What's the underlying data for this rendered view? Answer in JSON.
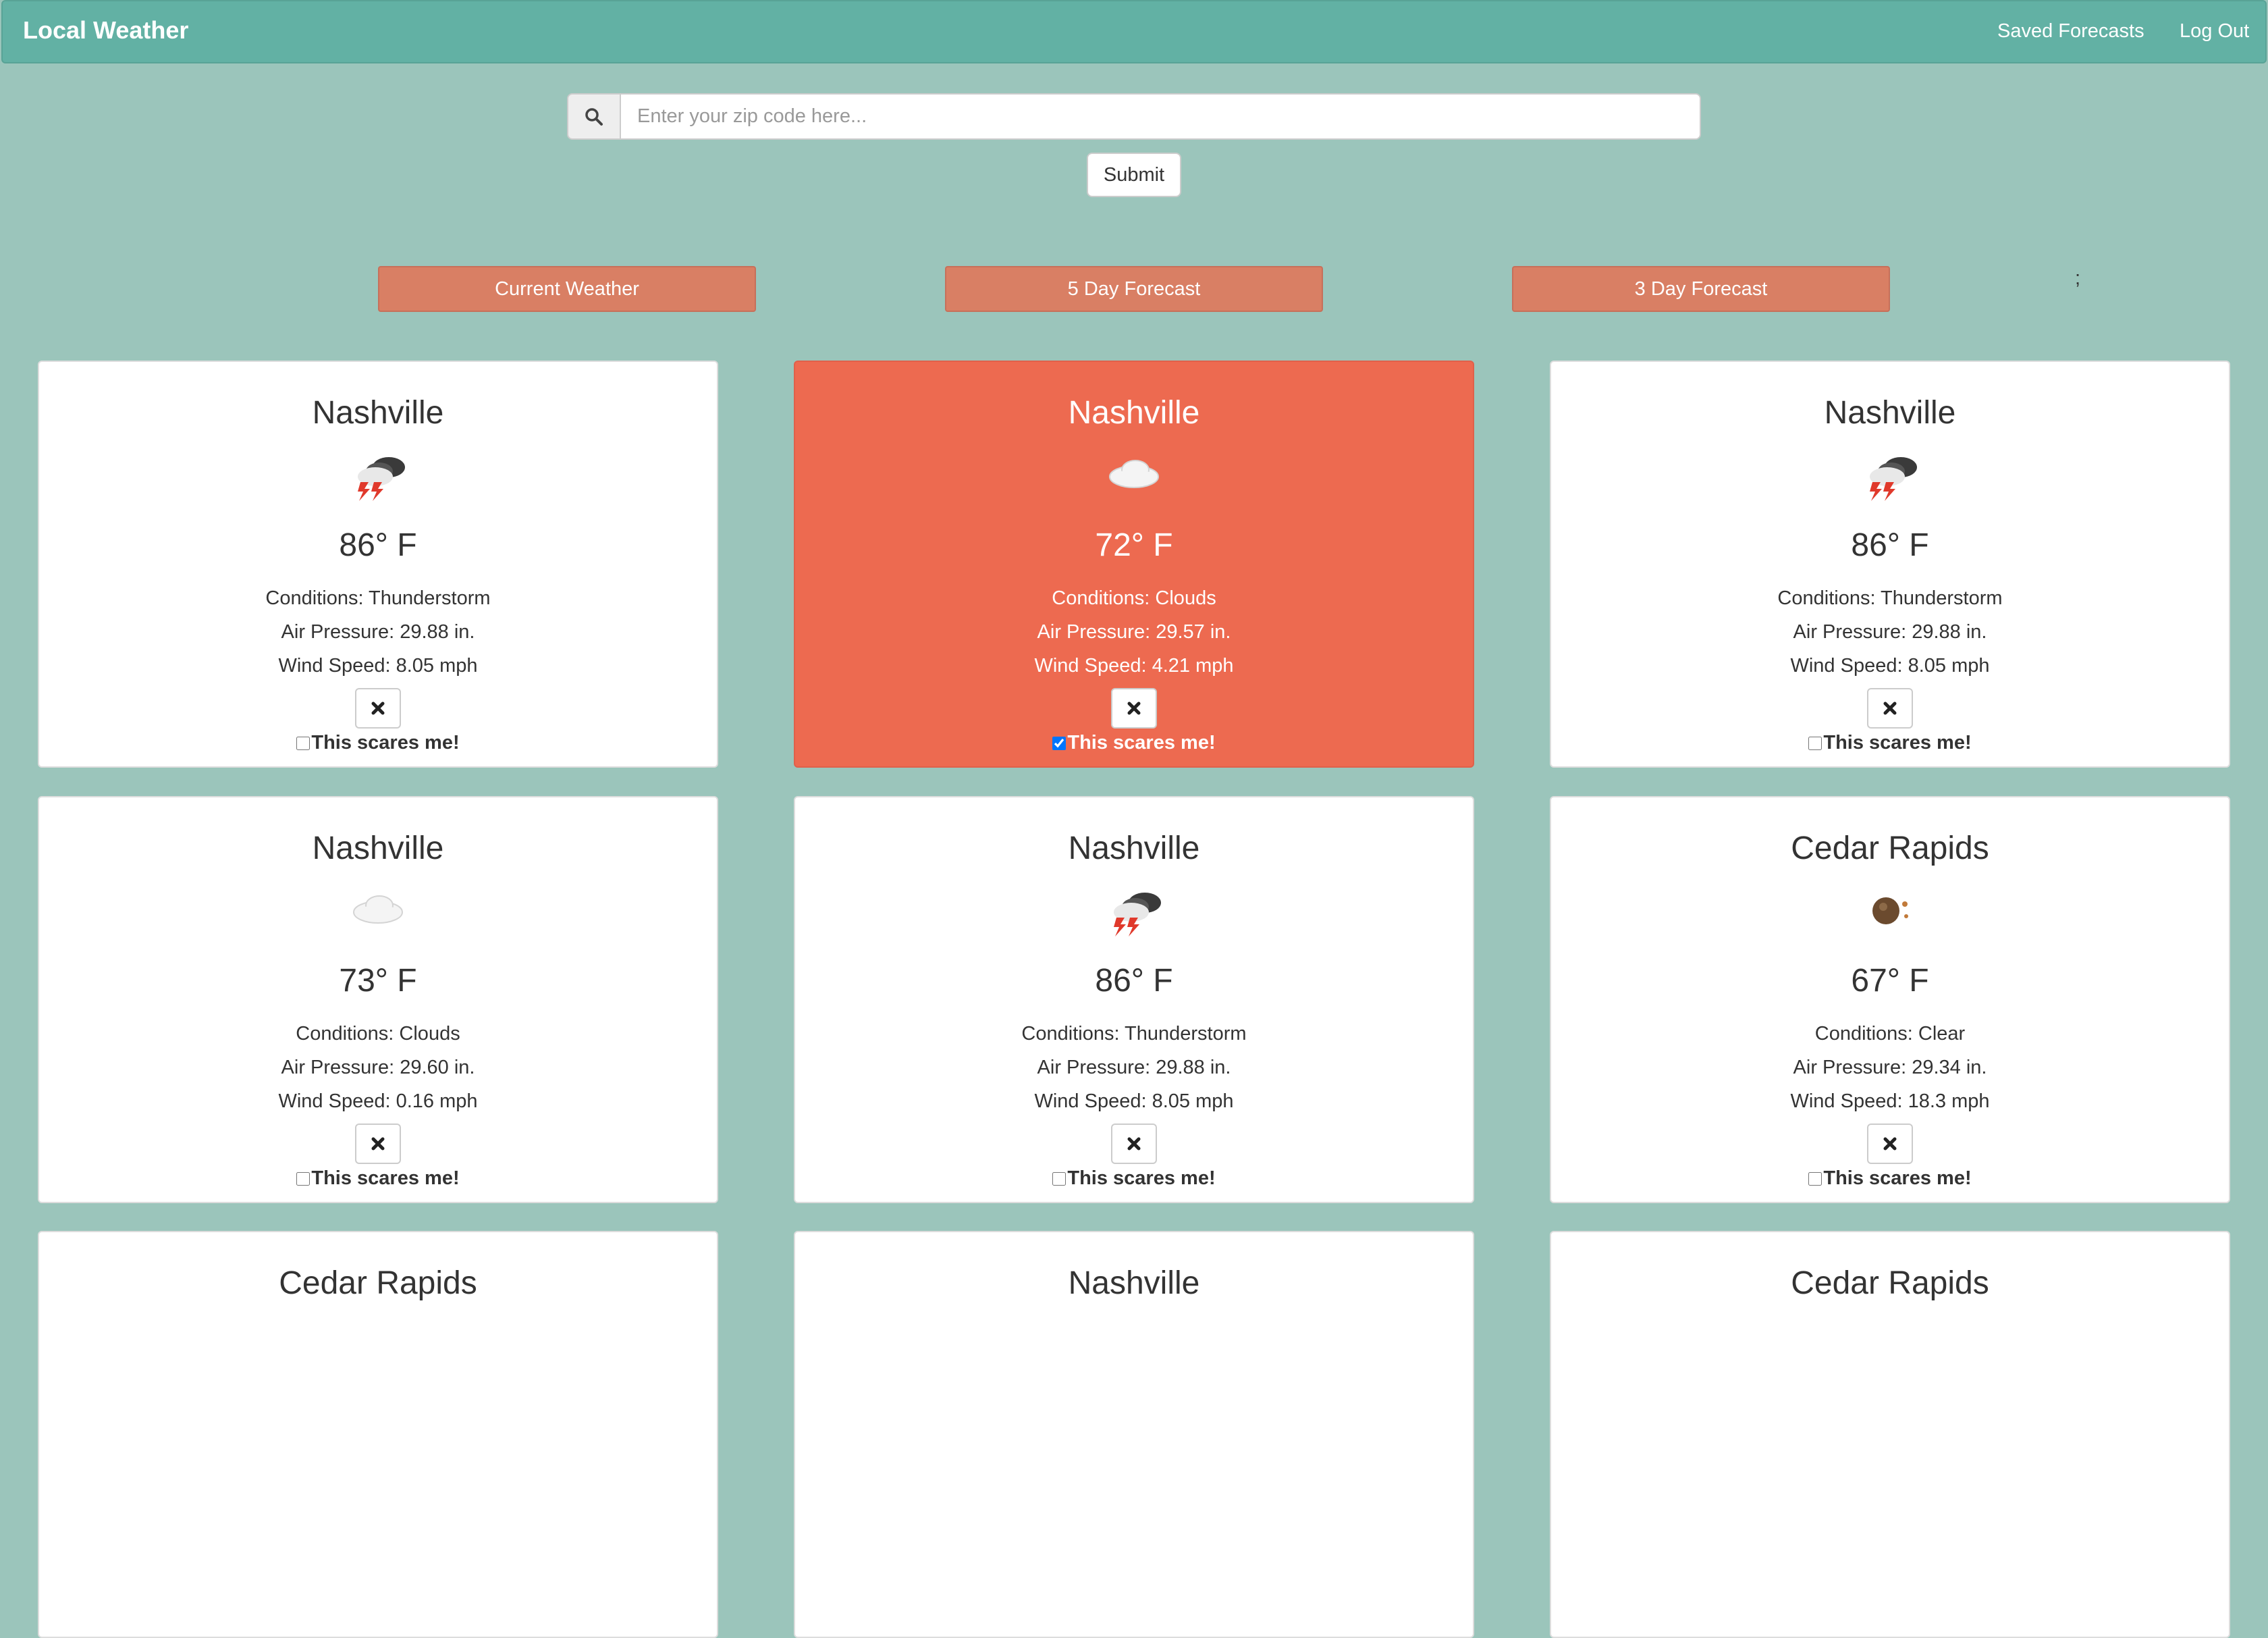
{
  "nav": {
    "brand": "Local Weather",
    "saved": "Saved Forecasts",
    "logout": "Log Out"
  },
  "search": {
    "placeholder": "Enter your zip code here...",
    "value": "",
    "submit": "Submit"
  },
  "tabs": [
    "Current Weather",
    "5 Day Forecast",
    "3 Day Forecast"
  ],
  "stray_text": ";",
  "cards": [
    {
      "city": "Nashville",
      "icon": "thunderstorm-icon",
      "temp": "86° F",
      "conditions": "Conditions: Thunderstorm",
      "pressure": "Air Pressure: 29.88 in.",
      "wind": "Wind Speed: 8.05 mph",
      "scare_label": "This scares me!",
      "checked": false
    },
    {
      "city": "Nashville",
      "icon": "cloud-icon",
      "temp": "72° F",
      "conditions": "Conditions: Clouds",
      "pressure": "Air Pressure: 29.57 in.",
      "wind": "Wind Speed: 4.21 mph",
      "scare_label": "This scares me!",
      "checked": true
    },
    {
      "city": "Nashville",
      "icon": "thunderstorm-icon",
      "temp": "86° F",
      "conditions": "Conditions: Thunderstorm",
      "pressure": "Air Pressure: 29.88 in.",
      "wind": "Wind Speed: 8.05 mph",
      "scare_label": "This scares me!",
      "checked": false
    },
    {
      "city": "Nashville",
      "icon": "cloud-icon",
      "temp": "73° F",
      "conditions": "Conditions: Clouds",
      "pressure": "Air Pressure: 29.60 in.",
      "wind": "Wind Speed: 0.16 mph",
      "scare_label": "This scares me!",
      "checked": false
    },
    {
      "city": "Nashville",
      "icon": "thunderstorm-icon",
      "temp": "86° F",
      "conditions": "Conditions: Thunderstorm",
      "pressure": "Air Pressure: 29.88 in.",
      "wind": "Wind Speed: 8.05 mph",
      "scare_label": "This scares me!",
      "checked": false
    },
    {
      "city": "Cedar Rapids",
      "icon": "clear-icon",
      "temp": "67° F",
      "conditions": "Conditions: Clear",
      "pressure": "Air Pressure: 29.34 in.",
      "wind": "Wind Speed: 18.3 mph",
      "scare_label": "This scares me!",
      "checked": false
    },
    {
      "city": "Cedar Rapids"
    },
    {
      "city": "Nashville"
    },
    {
      "city": "Cedar Rapids"
    }
  ],
  "colors": {
    "page_bg": "#9bc5bb",
    "navbar": "#62b1a4",
    "tab_button": "#d97f64",
    "highlight_card": "#ed6a50"
  }
}
